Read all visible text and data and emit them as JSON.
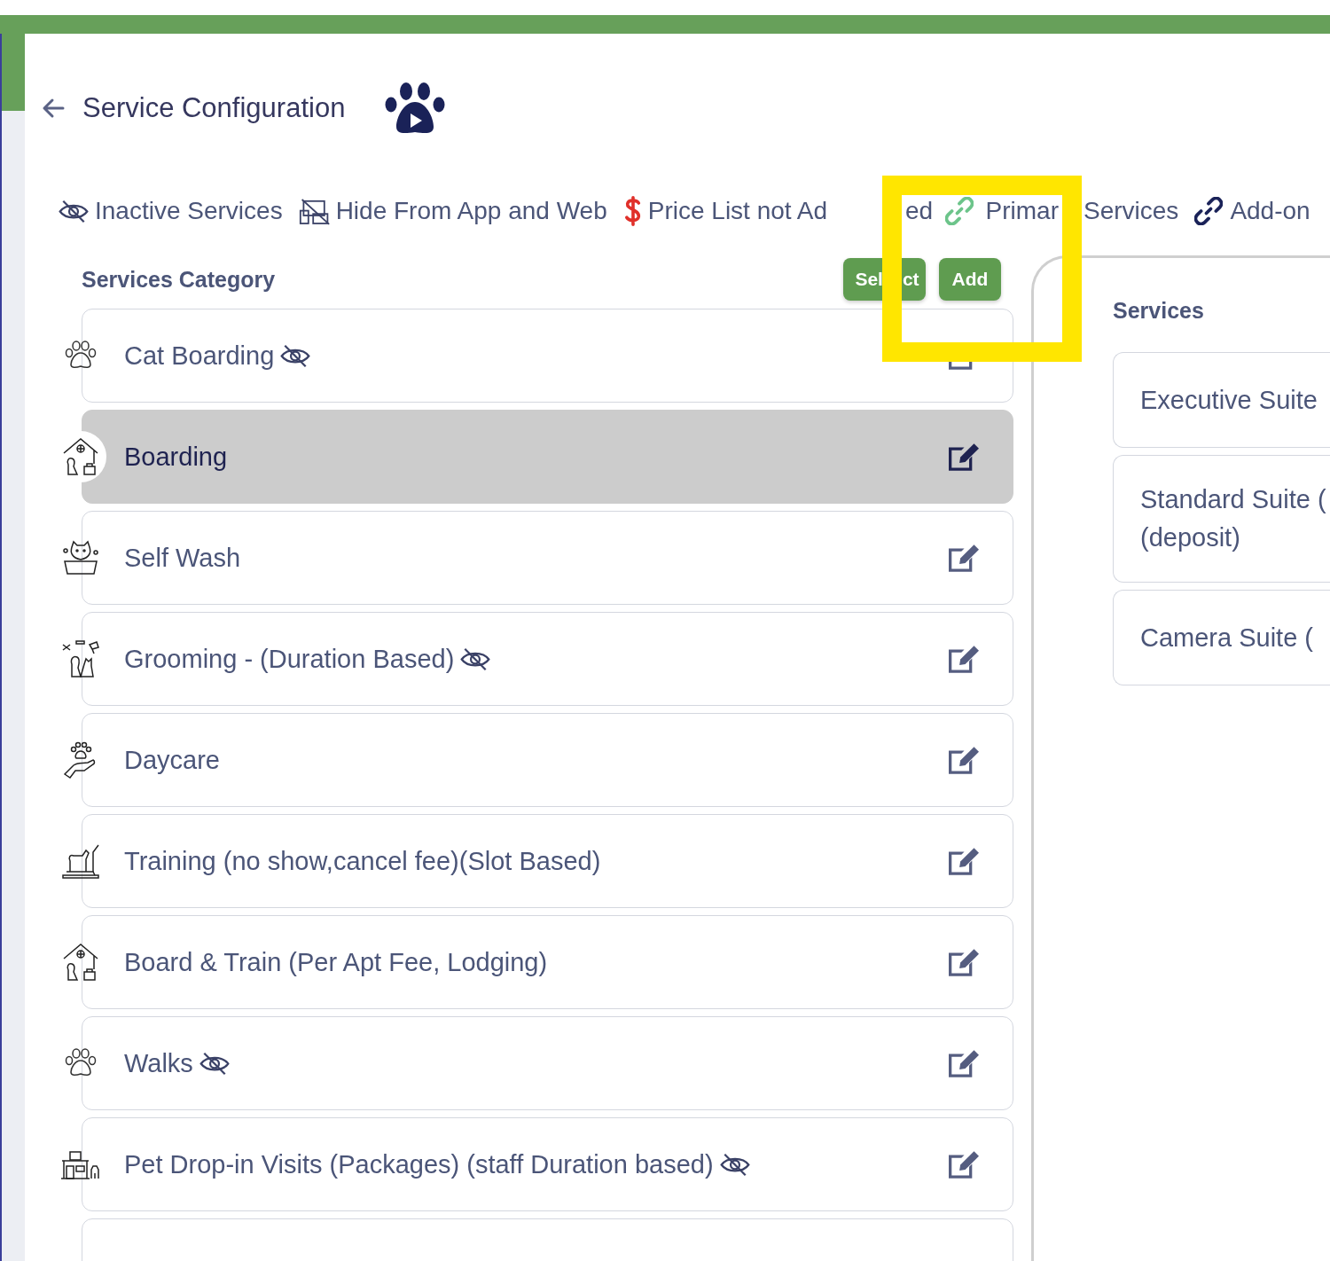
{
  "header": {
    "title": "Service Configuration"
  },
  "legend": [
    {
      "kind": "inactive",
      "label": [
        "Inactive Services"
      ]
    },
    {
      "kind": "hidden",
      "label": [
        "Hide From App and Web"
      ]
    },
    {
      "kind": "price",
      "label": [
        "Price List not Ad",
        "ed"
      ]
    },
    {
      "kind": "primary",
      "label": [
        "Primar",
        "Services"
      ]
    },
    {
      "kind": "addon",
      "label": [
        "Add-on"
      ]
    }
  ],
  "categories_panel": {
    "title": "Services Category",
    "buttons": [
      [
        "Sel",
        "ct"
      ],
      [
        "Add"
      ]
    ],
    "items": [
      {
        "name": "Cat Boarding",
        "kind": "paw",
        "inactive": true,
        "selected": false
      },
      {
        "name": "Boarding",
        "kind": "house-pets",
        "inactive": false,
        "selected": true
      },
      {
        "name": "Self Wash",
        "kind": "bath",
        "inactive": false,
        "selected": false
      },
      {
        "name": "Grooming - (Duration Based)",
        "kind": "grooming",
        "inactive": true,
        "selected": false
      },
      {
        "name": "Daycare",
        "kind": "hand-paw",
        "inactive": false,
        "selected": false
      },
      {
        "name": "Training (no show,cancel fee)(Slot Based)",
        "kind": "treadmill",
        "inactive": false,
        "selected": false
      },
      {
        "name": "Board & Train (Per Apt Fee, Lodging)",
        "kind": "house-pets",
        "inactive": false,
        "selected": false
      },
      {
        "name": "Walks",
        "kind": "paw",
        "inactive": true,
        "selected": false
      },
      {
        "name": "Pet Drop-in Visits (Packages) (staff Duration based)",
        "kind": "storefront",
        "inactive": true,
        "selected": false
      }
    ]
  },
  "services_panel": {
    "title": "Services",
    "items": [
      {
        "lines": [
          "Executive Suite"
        ]
      },
      {
        "lines": [
          "Standard Suite (",
          "(deposit)"
        ]
      },
      {
        "lines": [
          "Camera Suite ("
        ]
      }
    ]
  }
}
